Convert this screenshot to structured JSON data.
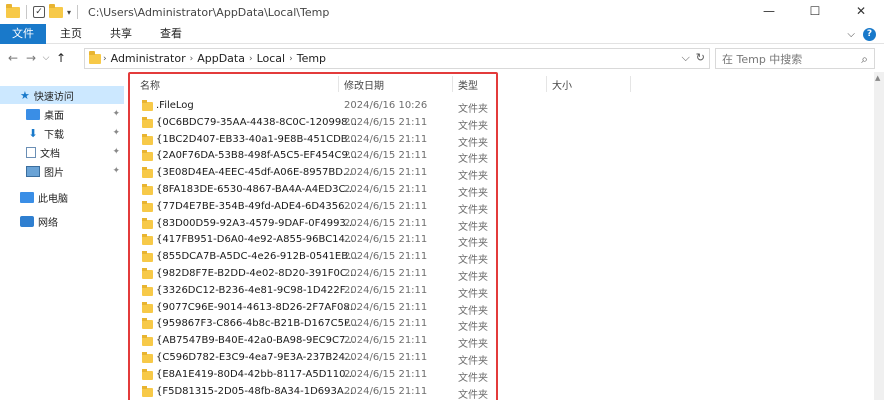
{
  "window": {
    "title_path": "C:\\Users\\Administrator\\AppData\\Local\\Temp",
    "controls": {
      "minimize": "—",
      "maximize": "☐",
      "close": "✕"
    }
  },
  "ribbon": {
    "tabs": [
      "文件",
      "主页",
      "共享",
      "查看"
    ],
    "expand": "⌵",
    "help": "?"
  },
  "nav": {
    "back": "←",
    "forward": "→",
    "dropdown": "⌵",
    "up": "↑",
    "breadcrumb": [
      "Administrator",
      "AppData",
      "Local",
      "Temp"
    ],
    "addr_dropdown": "⌵",
    "refresh": "↻",
    "search_placeholder": "在 Temp 中搜索"
  },
  "sidebar": {
    "items": [
      {
        "label": "快速访问",
        "pinned": false
      },
      {
        "label": "桌面",
        "pinned": true
      },
      {
        "label": "下载",
        "pinned": true
      },
      {
        "label": "文档",
        "pinned": true
      },
      {
        "label": "图片",
        "pinned": true
      },
      {
        "label": "此电脑",
        "pinned": false
      },
      {
        "label": "网络",
        "pinned": false
      }
    ],
    "pin_glyph": "📌"
  },
  "columns": {
    "name": "名称",
    "date": "修改日期",
    "type": "类型",
    "size": "大小"
  },
  "files": [
    {
      "name": ".FileLog",
      "date": "2024/6/16 10:26",
      "type": "文件夹"
    },
    {
      "name": "{0C6BDC79-35AA-4438-8C0C-120998...",
      "date": "2024/6/15 21:11",
      "type": "文件夹"
    },
    {
      "name": "{1BC2D407-EB33-40a1-9E8B-451CDB...",
      "date": "2024/6/15 21:11",
      "type": "文件夹"
    },
    {
      "name": "{2A0F76DA-53B8-498f-A5C5-EF454C9...",
      "date": "2024/6/15 21:11",
      "type": "文件夹"
    },
    {
      "name": "{3E08D4EA-4EEC-45df-A06E-8957BD...",
      "date": "2024/6/15 21:11",
      "type": "文件夹"
    },
    {
      "name": "{8FA183DE-6530-4867-BA4A-A4ED3C...",
      "date": "2024/6/15 21:11",
      "type": "文件夹"
    },
    {
      "name": "{77D4E7BE-354B-49fd-ADE4-6D4356...",
      "date": "2024/6/15 21:11",
      "type": "文件夹"
    },
    {
      "name": "{83D00D59-92A3-4579-9DAF-0F4993...",
      "date": "2024/6/15 21:11",
      "type": "文件夹"
    },
    {
      "name": "{417FB951-D6A0-4e92-A855-96BC14...",
      "date": "2024/6/15 21:11",
      "type": "文件夹"
    },
    {
      "name": "{855DCA7B-A5DC-4e26-912B-0541EB...",
      "date": "2024/6/15 21:11",
      "type": "文件夹"
    },
    {
      "name": "{982D8F7E-B2DD-4e02-8D20-391F0C...",
      "date": "2024/6/15 21:11",
      "type": "文件夹"
    },
    {
      "name": "{3326DC12-B236-4e81-9C98-1D422F...",
      "date": "2024/6/15 21:11",
      "type": "文件夹"
    },
    {
      "name": "{9077C96E-9014-4613-8D26-2F7AF08...",
      "date": "2024/6/15 21:11",
      "type": "文件夹"
    },
    {
      "name": "{959867F3-C866-4b8c-B21B-D167C5F...",
      "date": "2024/6/15 21:11",
      "type": "文件夹"
    },
    {
      "name": "{AB7547B9-B40E-42a0-BA98-9EC9C7...",
      "date": "2024/6/15 21:11",
      "type": "文件夹"
    },
    {
      "name": "{C596D782-E3C9-4ea7-9E3A-237B24...",
      "date": "2024/6/15 21:11",
      "type": "文件夹"
    },
    {
      "name": "{E8A1E419-80D4-42bb-8117-A5D110...",
      "date": "2024/6/15 21:11",
      "type": "文件夹"
    },
    {
      "name": "{F5D81315-2D05-48fb-8A34-1D693A...",
      "date": "2024/6/15 21:11",
      "type": "文件夹"
    }
  ],
  "colors": {
    "accent": "#1979CA",
    "highlight_box": "#E33B3B",
    "folder": "#F7C948",
    "selected_nav": "#CCE8FF"
  }
}
